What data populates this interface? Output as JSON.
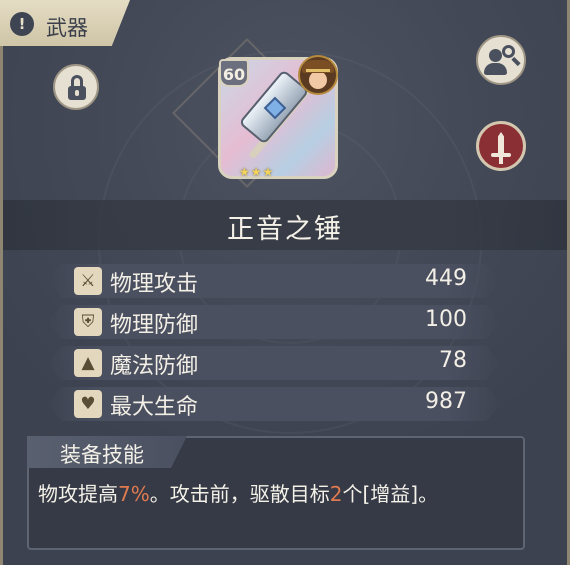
{
  "header": {
    "tab_label": "武器",
    "tab_icon": "!"
  },
  "weapon": {
    "name": "正音之锤",
    "level": "60",
    "stars": "★★★",
    "star_count": 3
  },
  "stats": [
    {
      "icon": "sword-icon",
      "glyph": "⚔",
      "label": "物理攻击",
      "value": "449"
    },
    {
      "icon": "shield-icon",
      "glyph": "⛨",
      "label": "物理防御",
      "value": "100"
    },
    {
      "icon": "wizard-hat-icon",
      "glyph": "▲",
      "label": "魔法防御",
      "value": "78"
    },
    {
      "icon": "heart-icon",
      "glyph": "♥",
      "label": "最大生命",
      "value": "987"
    }
  ],
  "skill": {
    "title": "装备技能",
    "desc_part1": "物攻提高",
    "desc_hl1": "7%",
    "desc_part2": "。攻击前，驱散目标",
    "desc_hl2": "2",
    "desc_part3": "个[增益]。"
  },
  "colors": {
    "background": "#3c4250",
    "highlight": "#e07a4f",
    "tab": "#e4dcc4",
    "type_badge": "#8a2f34"
  }
}
